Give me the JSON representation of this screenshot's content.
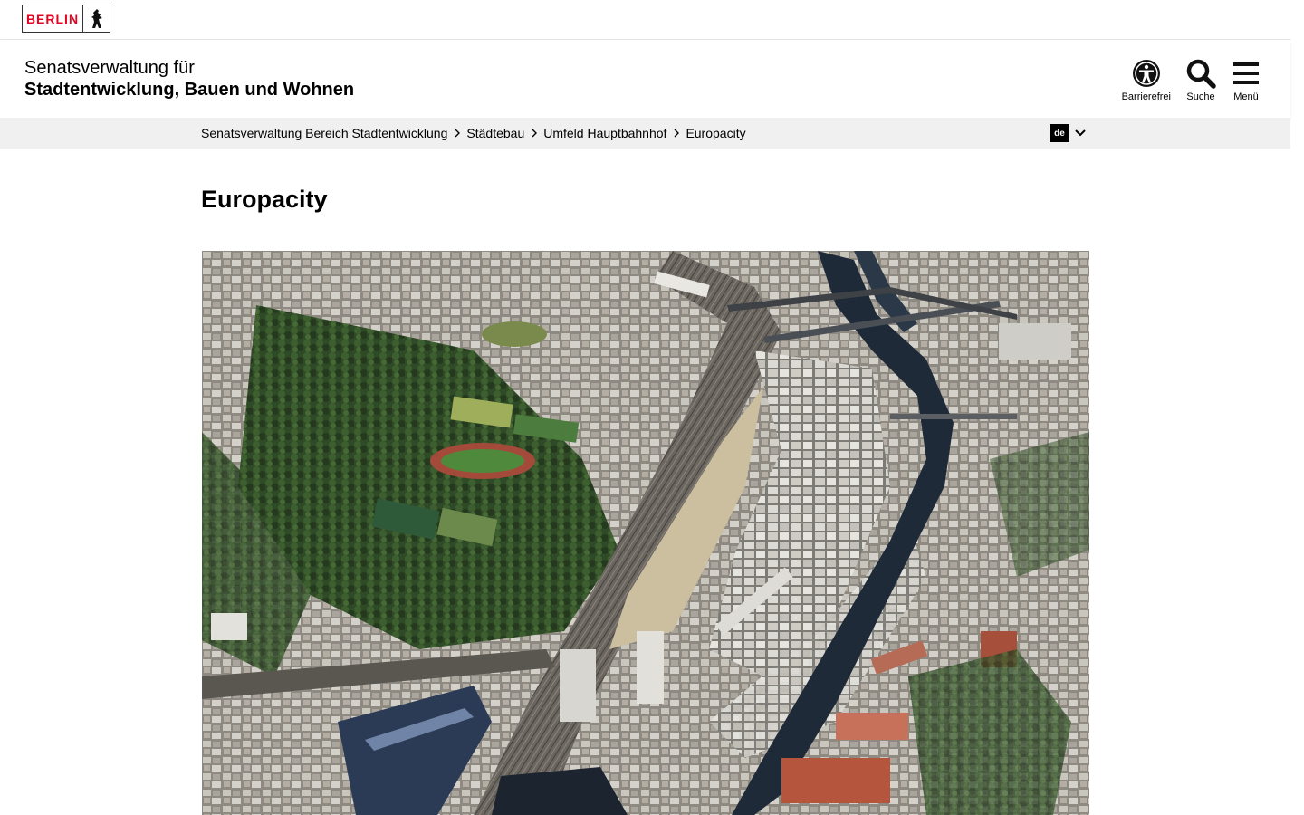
{
  "brand": {
    "logo_text": "BERLIN",
    "accent_color": "#e40422"
  },
  "header": {
    "org_line1": "Senatsverwaltung für",
    "org_line2": "Stadtentwicklung, Bauen und Wohnen",
    "tools": [
      {
        "label": "Barrierefrei",
        "icon": "accessibility-icon"
      },
      {
        "label": "Suche",
        "icon": "search-icon"
      },
      {
        "label": "Menü",
        "icon": "hamburger-icon"
      }
    ]
  },
  "breadcrumb": {
    "items": [
      "Senatsverwaltung Bereich Stadtentwicklung",
      "Städtebau",
      "Umfeld Hauptbahnhof",
      "Europacity"
    ]
  },
  "language": {
    "selected": "de"
  },
  "main": {
    "title": "Europacity"
  }
}
